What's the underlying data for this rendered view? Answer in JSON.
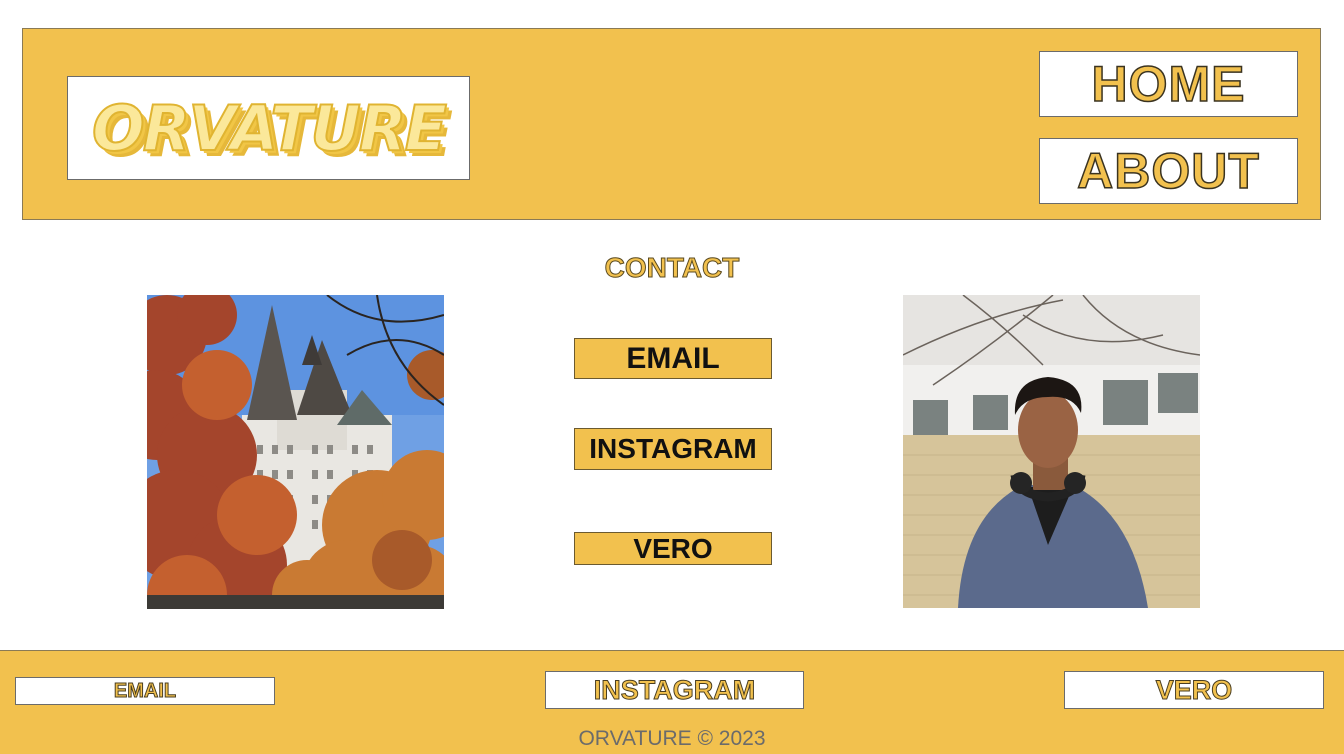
{
  "header": {
    "logo_text": "ORVATURE",
    "nav": {
      "home": "HOME",
      "about": "ABOUT"
    }
  },
  "main": {
    "title": "CONTACT",
    "buttons": {
      "email": "EMAIL",
      "instagram": "INSTAGRAM",
      "vero": "VERO"
    }
  },
  "footer": {
    "links": {
      "email": "EMAIL",
      "instagram": "INSTAGRAM",
      "vero": "VERO"
    },
    "copyright": "ORVATURE © 2023"
  },
  "colors": {
    "accent": "#f2c14e",
    "text_dark": "#111111",
    "muted": "#6b6b6b"
  }
}
